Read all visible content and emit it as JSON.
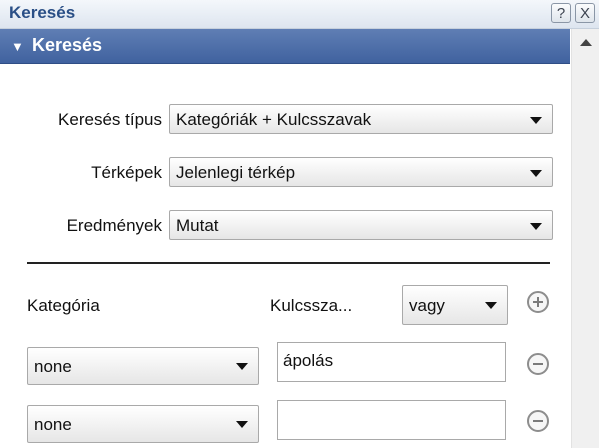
{
  "window": {
    "title": "Keresés",
    "help_label": "?",
    "close_label": "X"
  },
  "section": {
    "title": "Keresés",
    "expanded": true
  },
  "form": {
    "search_type": {
      "label": "Keresés típus",
      "value": "Kategóriák + Kulcsszavak"
    },
    "maps": {
      "label": "Térképek",
      "value": "Jelenlegi térkép"
    },
    "results": {
      "label": "Eredmények",
      "value": "Mutat"
    }
  },
  "criteria": {
    "category_header": "Kategória",
    "keyword_header": "Kulcssza...",
    "operator": "vagy",
    "rows": [
      {
        "category": "none",
        "keyword": "ápolás"
      },
      {
        "category": "none",
        "keyword": ""
      }
    ]
  },
  "colors": {
    "section_header": "#4a6aa6",
    "title_text": "#2a4f86"
  }
}
